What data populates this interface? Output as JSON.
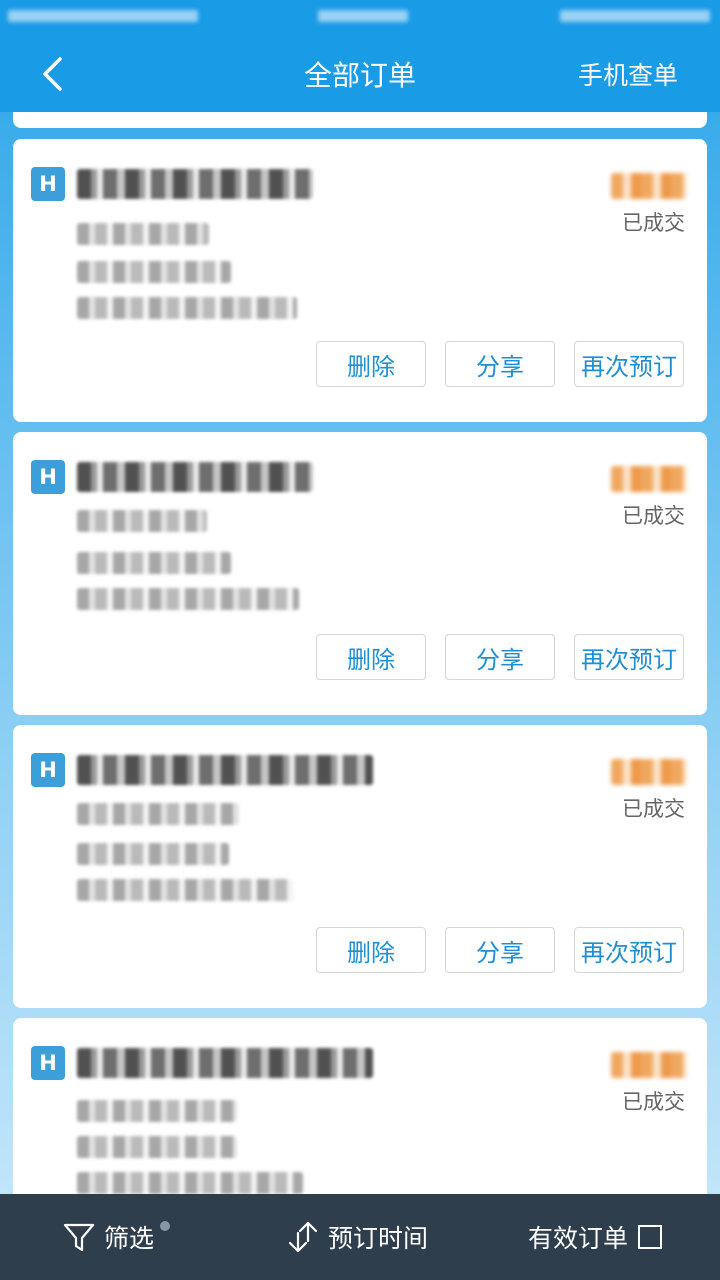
{
  "header": {
    "title": "全部订单",
    "right_action": "手机查单"
  },
  "orders": [
    {
      "status": "已成交",
      "buttons": {
        "delete": "删除",
        "share": "分享",
        "rebook": "再次预订"
      }
    },
    {
      "status": "已成交",
      "buttons": {
        "delete": "删除",
        "share": "分享",
        "rebook": "再次预订"
      }
    },
    {
      "status": "已成交",
      "buttons": {
        "delete": "删除",
        "share": "分享",
        "rebook": "再次预订"
      }
    },
    {
      "status": "已成交"
    }
  ],
  "order_icon_glyph": "H",
  "bottom_bar": {
    "filter": "筛选",
    "sort_by_booking_time": "预订时间",
    "valid_orders": "有效订单"
  },
  "colors": {
    "nav_bar": "#1a9be6",
    "button_text": "#1f8fd3",
    "bottom_bar": "#2f3e4d",
    "hotel_icon": "#3d9fd9"
  },
  "icons": [
    "back-arrow-icon",
    "hotel-icon",
    "filter-funnel-icon",
    "sort-arrows-icon",
    "checkbox-icon"
  ]
}
